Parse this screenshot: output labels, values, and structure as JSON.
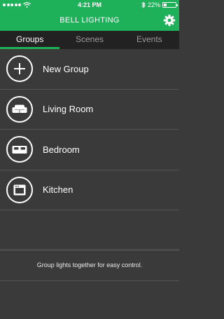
{
  "status_bar": {
    "carrier_dots": 5,
    "time": "4:21 PM",
    "battery_percent": "22%",
    "battery_level": 0.22
  },
  "app_bar": {
    "title": "BELL LIGHTING",
    "settings_icon": "gear-icon"
  },
  "tabs": [
    {
      "label": "Groups",
      "active": true
    },
    {
      "label": "Scenes",
      "active": false
    },
    {
      "label": "Events",
      "active": false
    }
  ],
  "groups": [
    {
      "label": "New Group",
      "icon": "plus-icon"
    },
    {
      "label": "Living Room",
      "icon": "sofa-icon"
    },
    {
      "label": "Bedroom",
      "icon": "bed-icon"
    },
    {
      "label": "Kitchen",
      "icon": "oven-icon"
    }
  ],
  "hint": "Group lights together for easy control.",
  "colors": {
    "accent": "#1fb05a",
    "background": "#3a3a3a",
    "tab_bar": "#222222"
  }
}
